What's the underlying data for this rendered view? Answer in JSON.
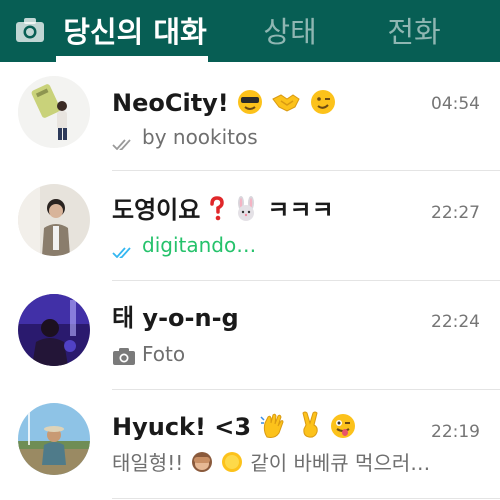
{
  "header": {
    "camera_icon": "camera-icon",
    "tabs": [
      {
        "label": "당신의 대화",
        "active": true
      },
      {
        "label": "상태",
        "active": false
      },
      {
        "label": "전화",
        "active": false
      }
    ]
  },
  "chats": [
    {
      "name": "NeoCity!",
      "name_emojis": [
        "smiling-face-with-sunglasses",
        "handshake",
        "winking-face"
      ],
      "time": "04:54",
      "preview": "by nookitos",
      "read_status": "delivered"
    },
    {
      "name": "도영이요",
      "name_suffix": "ㅋㅋㅋ",
      "name_emojis": [
        "red-question-mark",
        "rabbit-face"
      ],
      "time": "22:27",
      "preview": "digitando…",
      "read_status": "read"
    },
    {
      "name": "태 y-o-n-g",
      "time": "22:24",
      "preview": "Foto",
      "preview_icon": "camera-icon"
    },
    {
      "name": "Hyuck! <3",
      "name_emojis": [
        "waving-hand",
        "victory-hand",
        "winking-face-with-tongue"
      ],
      "time": "22:19",
      "preview_prefix": "태일형!!",
      "preview": "같이 바베큐 먹으러…",
      "preview_emojis": [
        "see-no-evil-monkey",
        "sun"
      ]
    }
  ],
  "colors": {
    "header_bg": "#075e54",
    "read_tick": "#34b7f1",
    "typing_green": "#25c26b",
    "time_gray": "#757575"
  }
}
